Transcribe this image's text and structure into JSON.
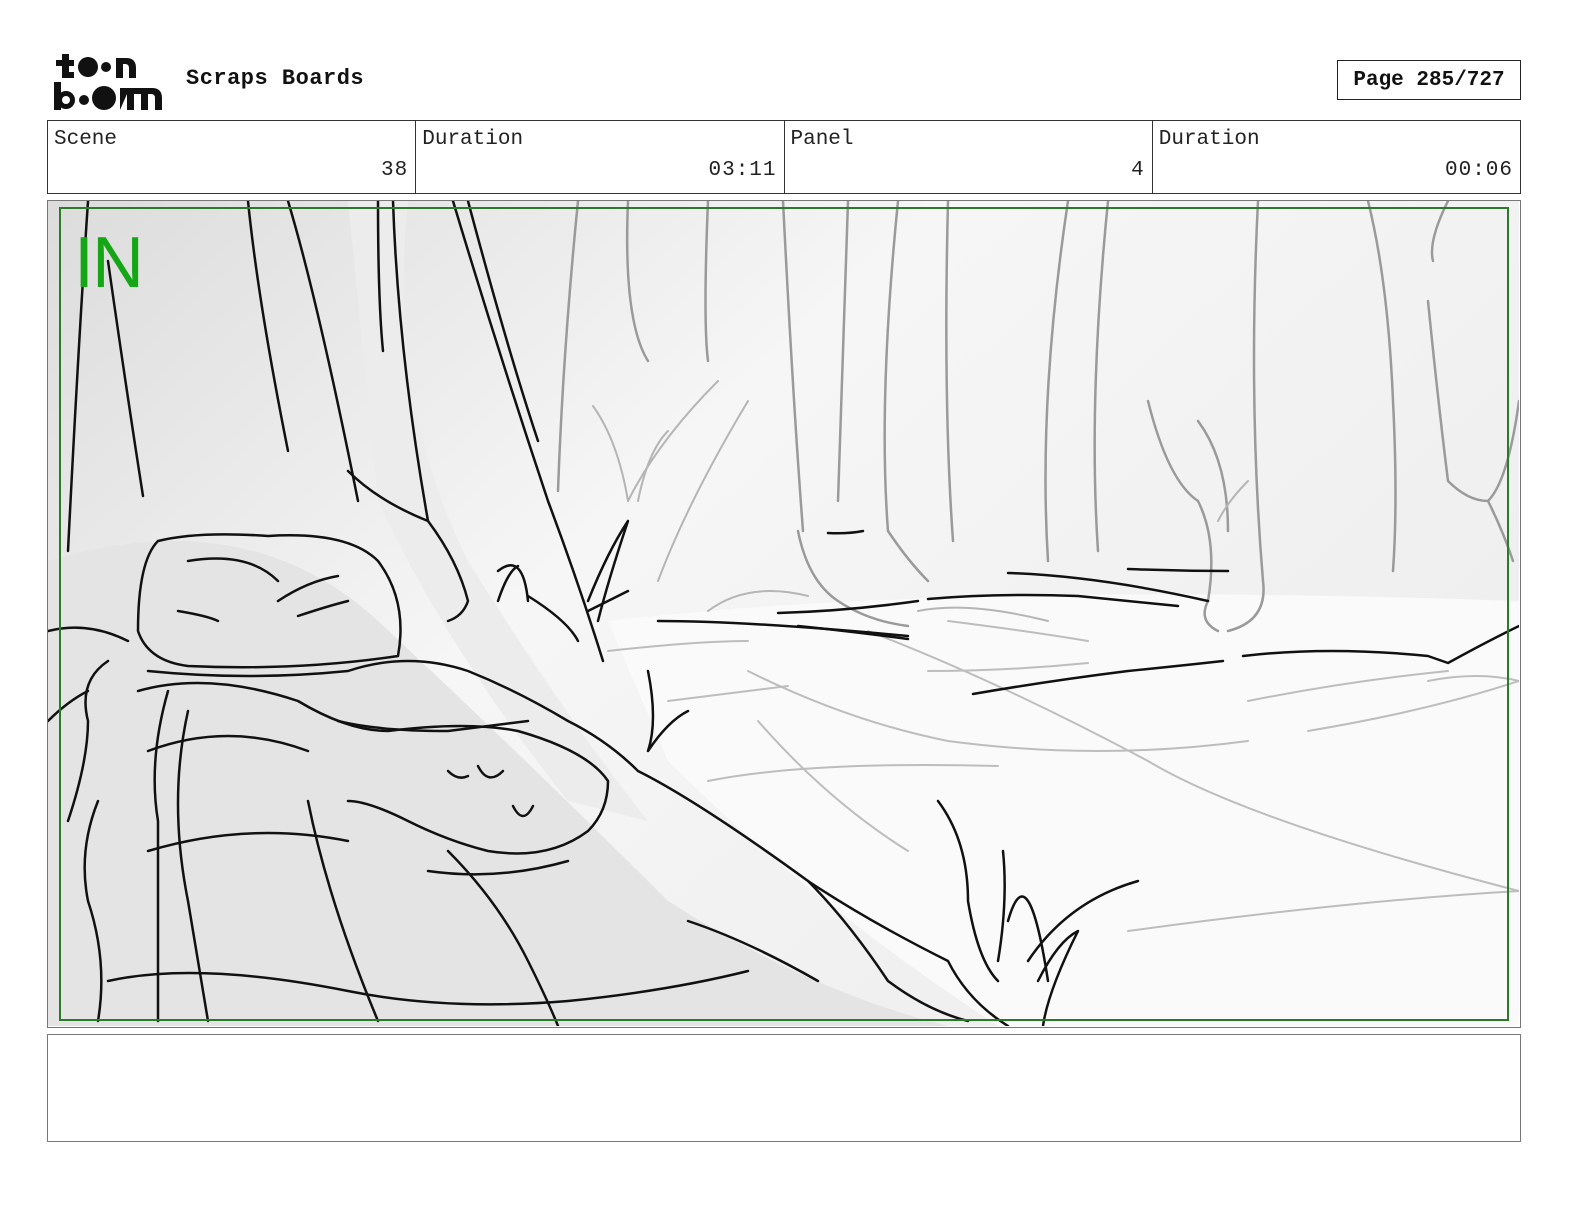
{
  "header": {
    "logo_text": "toon boom",
    "project_title": "Scraps Boards",
    "page_indicator": "Page 285/727"
  },
  "info": {
    "scene_label": "Scene",
    "scene_value": "38",
    "scene_duration_label": "Duration",
    "scene_duration_value": "03:11",
    "panel_label": "Panel",
    "panel_value": "4",
    "panel_duration_label": "Duration",
    "panel_duration_value": "00:06"
  },
  "panel": {
    "transition_marker": "IN",
    "marker_color": "#14a614",
    "safe_frame_color": "#2a7a2a"
  },
  "notes": {
    "text": ""
  }
}
